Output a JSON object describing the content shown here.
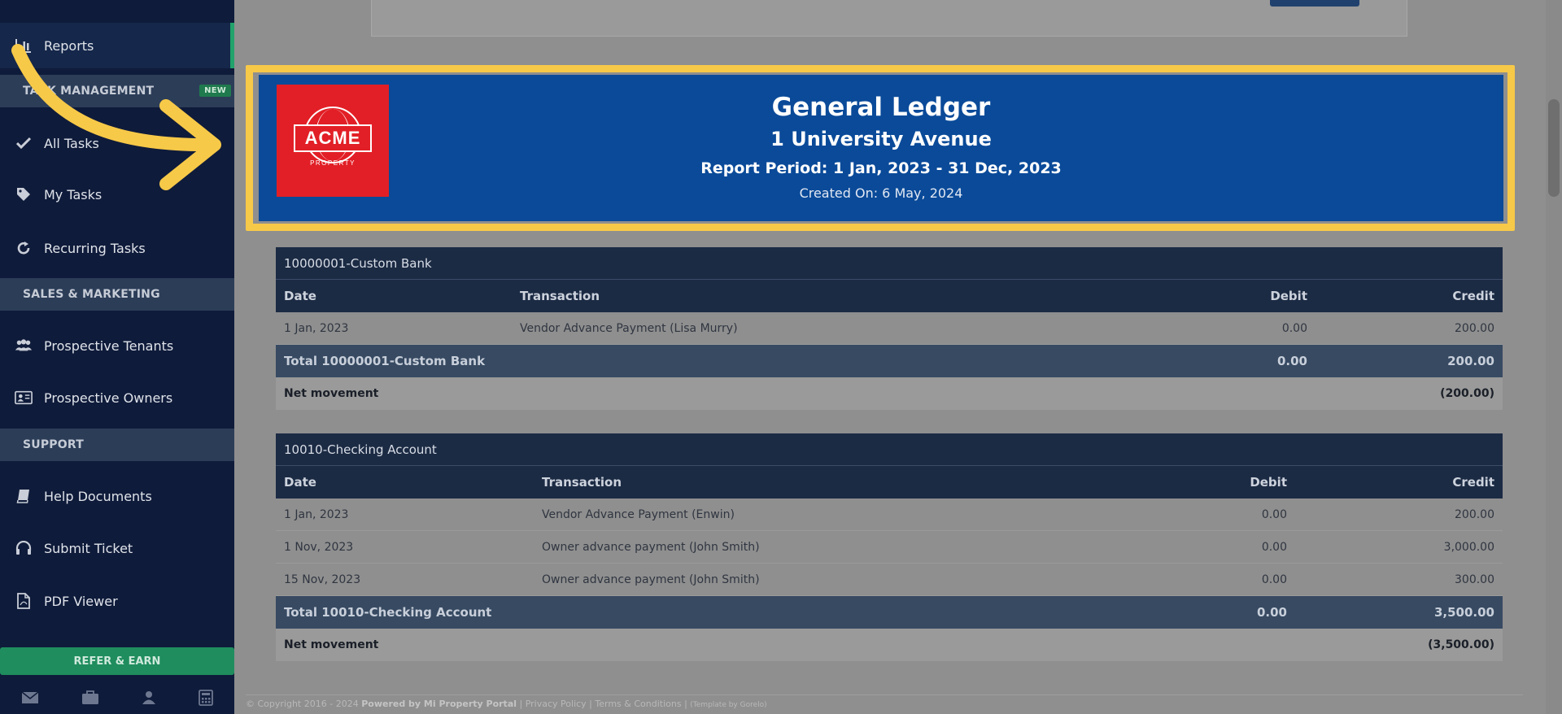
{
  "sidebar": {
    "reports": "Reports",
    "task_management_header": "TASK MANAGEMENT",
    "new_badge": "NEW",
    "all_tasks": "All Tasks",
    "my_tasks": "My Tasks",
    "recurring_tasks": "Recurring Tasks",
    "sales_header": "SALES & MARKETING",
    "prospective_tenants": "Prospective Tenants",
    "prospective_owners": "Prospective Owners",
    "support_header": "SUPPORT",
    "help_documents": "Help Documents",
    "submit_ticket": "Submit Ticket",
    "pdf_viewer": "PDF Viewer",
    "refer_earn": "REFER & EARN",
    "bottom_icons": [
      "mail-icon",
      "briefcase-icon",
      "user-icon",
      "calculator-icon"
    ]
  },
  "report_header": {
    "logo_text": "ACME",
    "logo_subtext": "PROPERTY",
    "title": "General Ledger",
    "property": "1 University Avenue",
    "period": "Report Period: 1 Jan, 2023 - 31 Dec, 2023",
    "created": "Created On: 6 May, 2024"
  },
  "ledgers": [
    {
      "account": "10000001-Custom Bank",
      "headers": {
        "date": "Date",
        "transaction": "Transaction",
        "debit": "Debit",
        "credit": "Credit"
      },
      "rows": [
        {
          "date": "1 Jan, 2023",
          "transaction": "Vendor Advance Payment (Lisa Murry)",
          "debit": "0.00",
          "credit": "200.00"
        }
      ],
      "total": {
        "label": "Total 10000001-Custom Bank",
        "debit": "0.00",
        "credit": "200.00"
      },
      "net": {
        "label": "Net movement",
        "value": "(200.00)"
      }
    },
    {
      "account": "10010-Checking Account",
      "headers": {
        "date": "Date",
        "transaction": "Transaction",
        "debit": "Debit",
        "credit": "Credit"
      },
      "rows": [
        {
          "date": "1 Jan, 2023",
          "transaction": "Vendor Advance Payment (Enwin)",
          "debit": "0.00",
          "credit": "200.00"
        },
        {
          "date": "1 Nov, 2023",
          "transaction": "Owner advance payment (John Smith)",
          "debit": "0.00",
          "credit": "3,000.00"
        },
        {
          "date": "15 Nov, 2023",
          "transaction": "Owner advance payment (John Smith)",
          "debit": "0.00",
          "credit": "300.00"
        }
      ],
      "total": {
        "label": "Total 10010-Checking Account",
        "debit": "0.00",
        "credit": "3,500.00"
      },
      "net": {
        "label": "Net movement",
        "value": "(3,500.00)"
      }
    }
  ],
  "footer": {
    "copyright": "© Copyright 2016 - 2024",
    "powered": "Powered by Mi Property Portal",
    "privacy": "Privacy Policy",
    "terms": "Terms & Conditions",
    "template": "(Template by Gorelo)"
  },
  "colors": {
    "highlight": "#f7c948",
    "header_band": "#0a4a99",
    "logo_red": "#e21f26",
    "sidebar_bg": "#0f1b3a",
    "accent_green": "#21a36b"
  }
}
